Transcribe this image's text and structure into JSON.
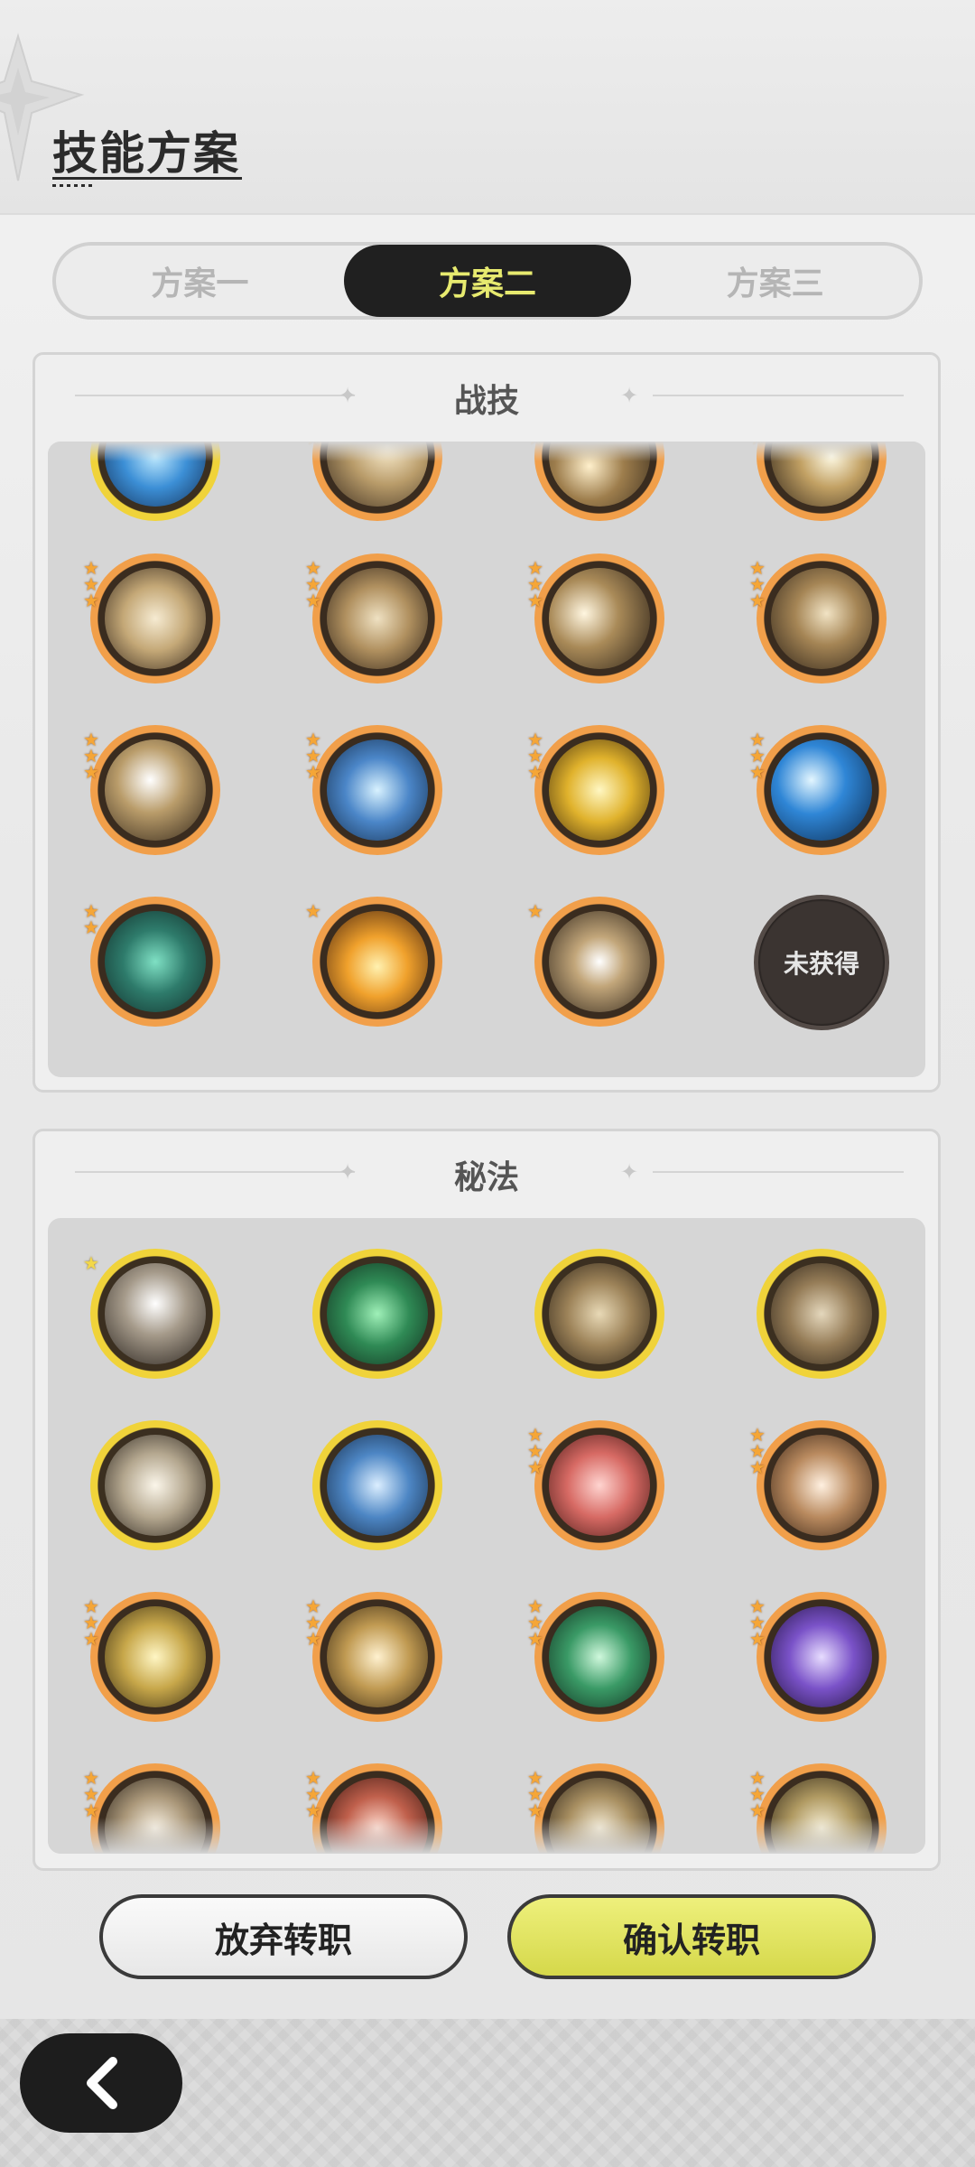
{
  "header": {
    "title": "技能方案"
  },
  "tabs": [
    {
      "label": "方案一",
      "active": false
    },
    {
      "label": "方案二",
      "active": true
    },
    {
      "label": "方案三",
      "active": false
    }
  ],
  "combat_skills": {
    "title": "战技",
    "locked_label": "未获得",
    "icons": [
      "ice-crystal-icon",
      "wind-slash-icon",
      "whirlwind-icon",
      "star-burst-icon",
      "muscle-flex-icon",
      "stampede-icon",
      "dash-attack-icon",
      "crescent-slash-icon",
      "uppercut-icon",
      "shield-aura-icon",
      "power-up-icon",
      "blue-slash-icon",
      "web-net-icon",
      "flame-strike-icon",
      "sparkle-vortex-icon",
      "locked-icon"
    ]
  },
  "secret_arts": {
    "title": "秘法",
    "icons": [
      "broken-blade-icon",
      "green-cross-icon",
      "dragon-icon",
      "shield-breaker-icon",
      "sword-icon",
      "water-shield-icon",
      "red-sword-icon",
      "heart-shield-icon",
      "golden-hex-icon",
      "armor-icon",
      "heal-heart-icon",
      "purple-beast-icon",
      "sword-upgrade-icon",
      "red-shield-icon",
      "eye-icon",
      "turtle-shell-icon"
    ]
  },
  "buttons": {
    "abandon": "放弃转职",
    "confirm": "确认转职"
  },
  "colors": {
    "accent": "#e7ea6f",
    "ring_orange": "#f19f4a",
    "ring_gold": "#f0d33a"
  }
}
